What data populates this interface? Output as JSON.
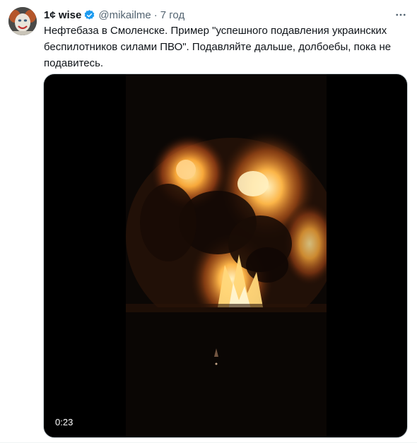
{
  "author": {
    "display_name": "1¢ wise",
    "handle": "@mikailme",
    "separator": "·",
    "time_ago": "7 год"
  },
  "tweet": {
    "lines": [
      "Нефтебаза в Смоленске. Пример \"успешного подавления украинских",
      "беспилотников силами ПВО\". Подавляйте дальше, долбоебы, пока не",
      "подавитесь."
    ]
  },
  "media": {
    "duration": "0:23"
  },
  "icons": {
    "avatar": "clown-avatar",
    "verified": "verified-badge-icon",
    "more": "more-options-icon"
  },
  "colors": {
    "verified": "#1d9bf0",
    "secondary_text": "#536471",
    "primary_text": "#0f1419",
    "fire_core": "#ffe79a",
    "fire_outer": "#e2641a"
  }
}
